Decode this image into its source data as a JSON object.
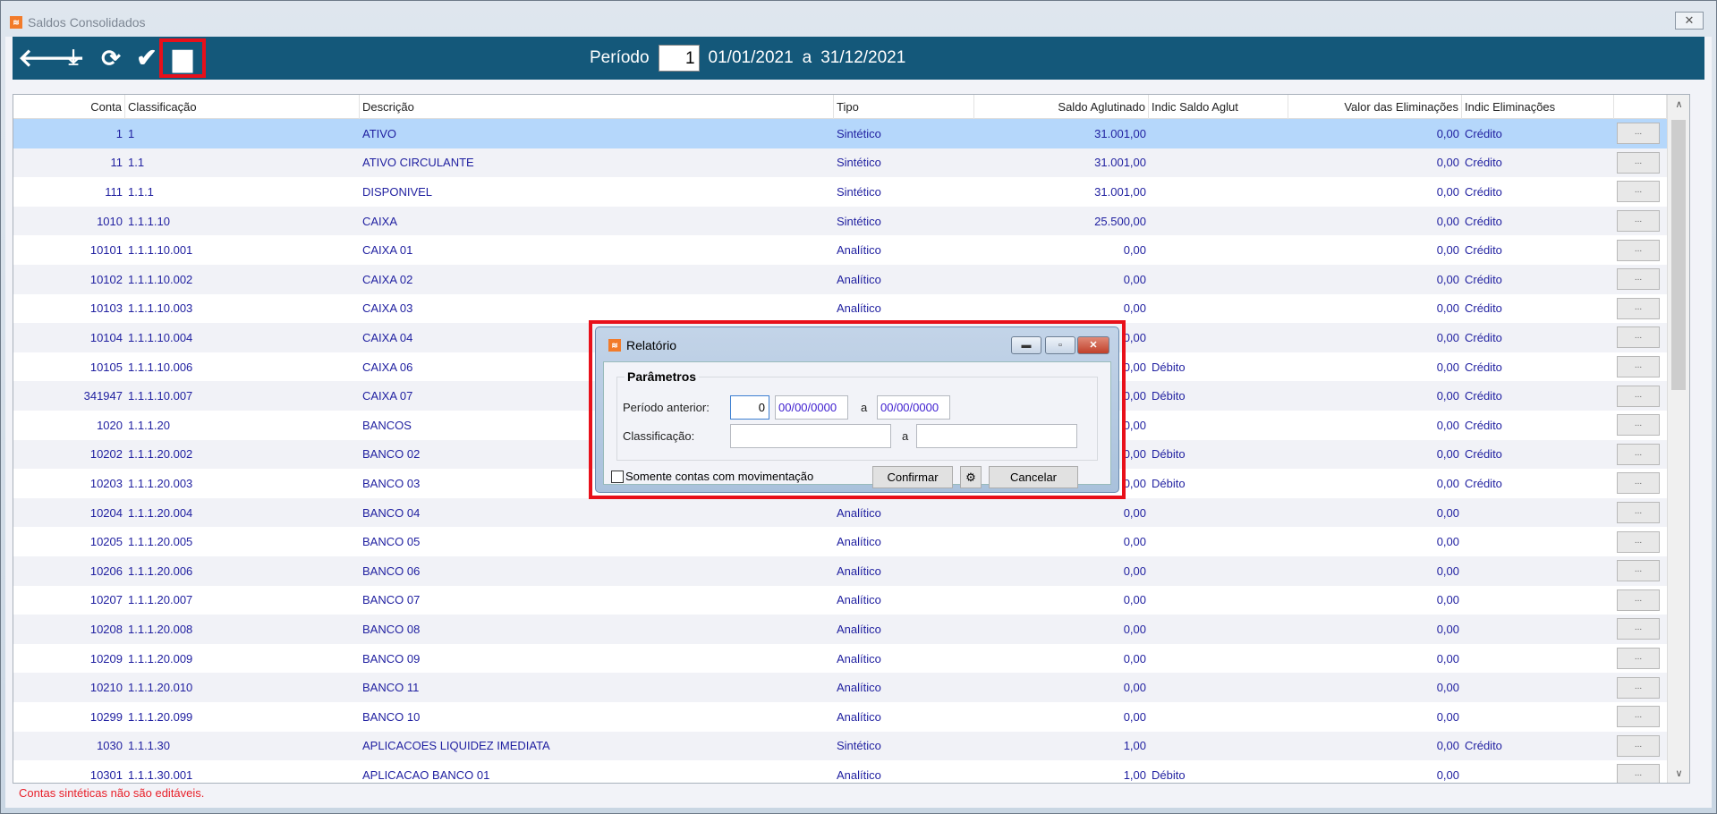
{
  "window": {
    "title": "Saldos Consolidados",
    "close": "✕"
  },
  "toolbar": {
    "period_label": "Período",
    "period_value": "1",
    "start_date": "01/01/2021",
    "sep": "a",
    "end_date": "31/12/2021"
  },
  "columns": [
    "Conta",
    "Classificação",
    "Descrição",
    "Tipo",
    "Saldo Aglutinado",
    "Indic Saldo Aglut",
    "Valor das Eliminações",
    "Indic Eliminações"
  ],
  "rows": [
    [
      "1",
      "1",
      "ATIVO",
      "Sintético",
      "31.001,00",
      "",
      "0,00",
      "Crédito"
    ],
    [
      "11",
      "1.1",
      "ATIVO CIRCULANTE",
      "Sintético",
      "31.001,00",
      "",
      "0,00",
      "Crédito"
    ],
    [
      "111",
      "1.1.1",
      "DISPONIVEL",
      "Sintético",
      "31.001,00",
      "",
      "0,00",
      "Crédito"
    ],
    [
      "1010",
      "1.1.1.10",
      "CAIXA",
      "Sintético",
      "25.500,00",
      "",
      "0,00",
      "Crédito"
    ],
    [
      "10101",
      "1.1.1.10.001",
      "CAIXA 01",
      "Analítico",
      "0,00",
      "",
      "0,00",
      "Crédito"
    ],
    [
      "10102",
      "1.1.1.10.002",
      "CAIXA 02",
      "Analítico",
      "0,00",
      "",
      "0,00",
      "Crédito"
    ],
    [
      "10103",
      "1.1.1.10.003",
      "CAIXA 03",
      "Analítico",
      "0,00",
      "",
      "0,00",
      "Crédito"
    ],
    [
      "10104",
      "1.1.1.10.004",
      "CAIXA 04",
      "",
      "0,00",
      "",
      "0,00",
      "Crédito"
    ],
    [
      "10105",
      "1.1.1.10.006",
      "CAIXA 06",
      "",
      "0,00",
      "Débito",
      "0,00",
      "Crédito"
    ],
    [
      "341947",
      "1.1.1.10.007",
      "CAIXA 07",
      "",
      "0,00",
      "Débito",
      "0,00",
      "Crédito"
    ],
    [
      "1020",
      "1.1.1.20",
      "BANCOS",
      "",
      "0,00",
      "",
      "0,00",
      "Crédito"
    ],
    [
      "10202",
      "1.1.1.20.002",
      "BANCO 02",
      "",
      "0,00",
      "Débito",
      "0,00",
      "Crédito"
    ],
    [
      "10203",
      "1.1.1.20.003",
      "BANCO 03",
      "",
      "0,00",
      "Débito",
      "0,00",
      "Crédito"
    ],
    [
      "10204",
      "1.1.1.20.004",
      "BANCO 04",
      "Analítico",
      "0,00",
      "",
      "0,00",
      ""
    ],
    [
      "10205",
      "1.1.1.20.005",
      "BANCO 05",
      "Analítico",
      "0,00",
      "",
      "0,00",
      ""
    ],
    [
      "10206",
      "1.1.1.20.006",
      "BANCO 06",
      "Analítico",
      "0,00",
      "",
      "0,00",
      ""
    ],
    [
      "10207",
      "1.1.1.20.007",
      "BANCO 07",
      "Analítico",
      "0,00",
      "",
      "0,00",
      ""
    ],
    [
      "10208",
      "1.1.1.20.008",
      "BANCO 08",
      "Analítico",
      "0,00",
      "",
      "0,00",
      ""
    ],
    [
      "10209",
      "1.1.1.20.009",
      "BANCO 09",
      "Analítico",
      "0,00",
      "",
      "0,00",
      ""
    ],
    [
      "10210",
      "1.1.1.20.010",
      "BANCO 11",
      "Analítico",
      "0,00",
      "",
      "0,00",
      ""
    ],
    [
      "10299",
      "1.1.1.20.099",
      "BANCO 10",
      "Analítico",
      "0,00",
      "",
      "0,00",
      ""
    ],
    [
      "1030",
      "1.1.1.30",
      "APLICACOES LIQUIDEZ IMEDIATA",
      "Sintético",
      "1,00",
      "",
      "0,00",
      "Crédito"
    ],
    [
      "10301",
      "1.1.1.30.001",
      "APLICACAO BANCO 01",
      "Analítico",
      "1,00",
      "Débito",
      "0,00",
      ""
    ]
  ],
  "row_button": "...",
  "status": "Contas sintéticas não são editáveis.",
  "dialog": {
    "title": "Relatório",
    "group": "Parâmetros",
    "periodo_label": "Período anterior:",
    "periodo_value": "0",
    "date_from": "00/00/0000",
    "sep": "a",
    "date_to": "00/00/0000",
    "class_label": "Classificação:",
    "class_from": "",
    "class_to": "",
    "checkbox_label": "Somente contas com movimentação",
    "confirm": "Confirmar",
    "cancel": "Cancelar"
  }
}
